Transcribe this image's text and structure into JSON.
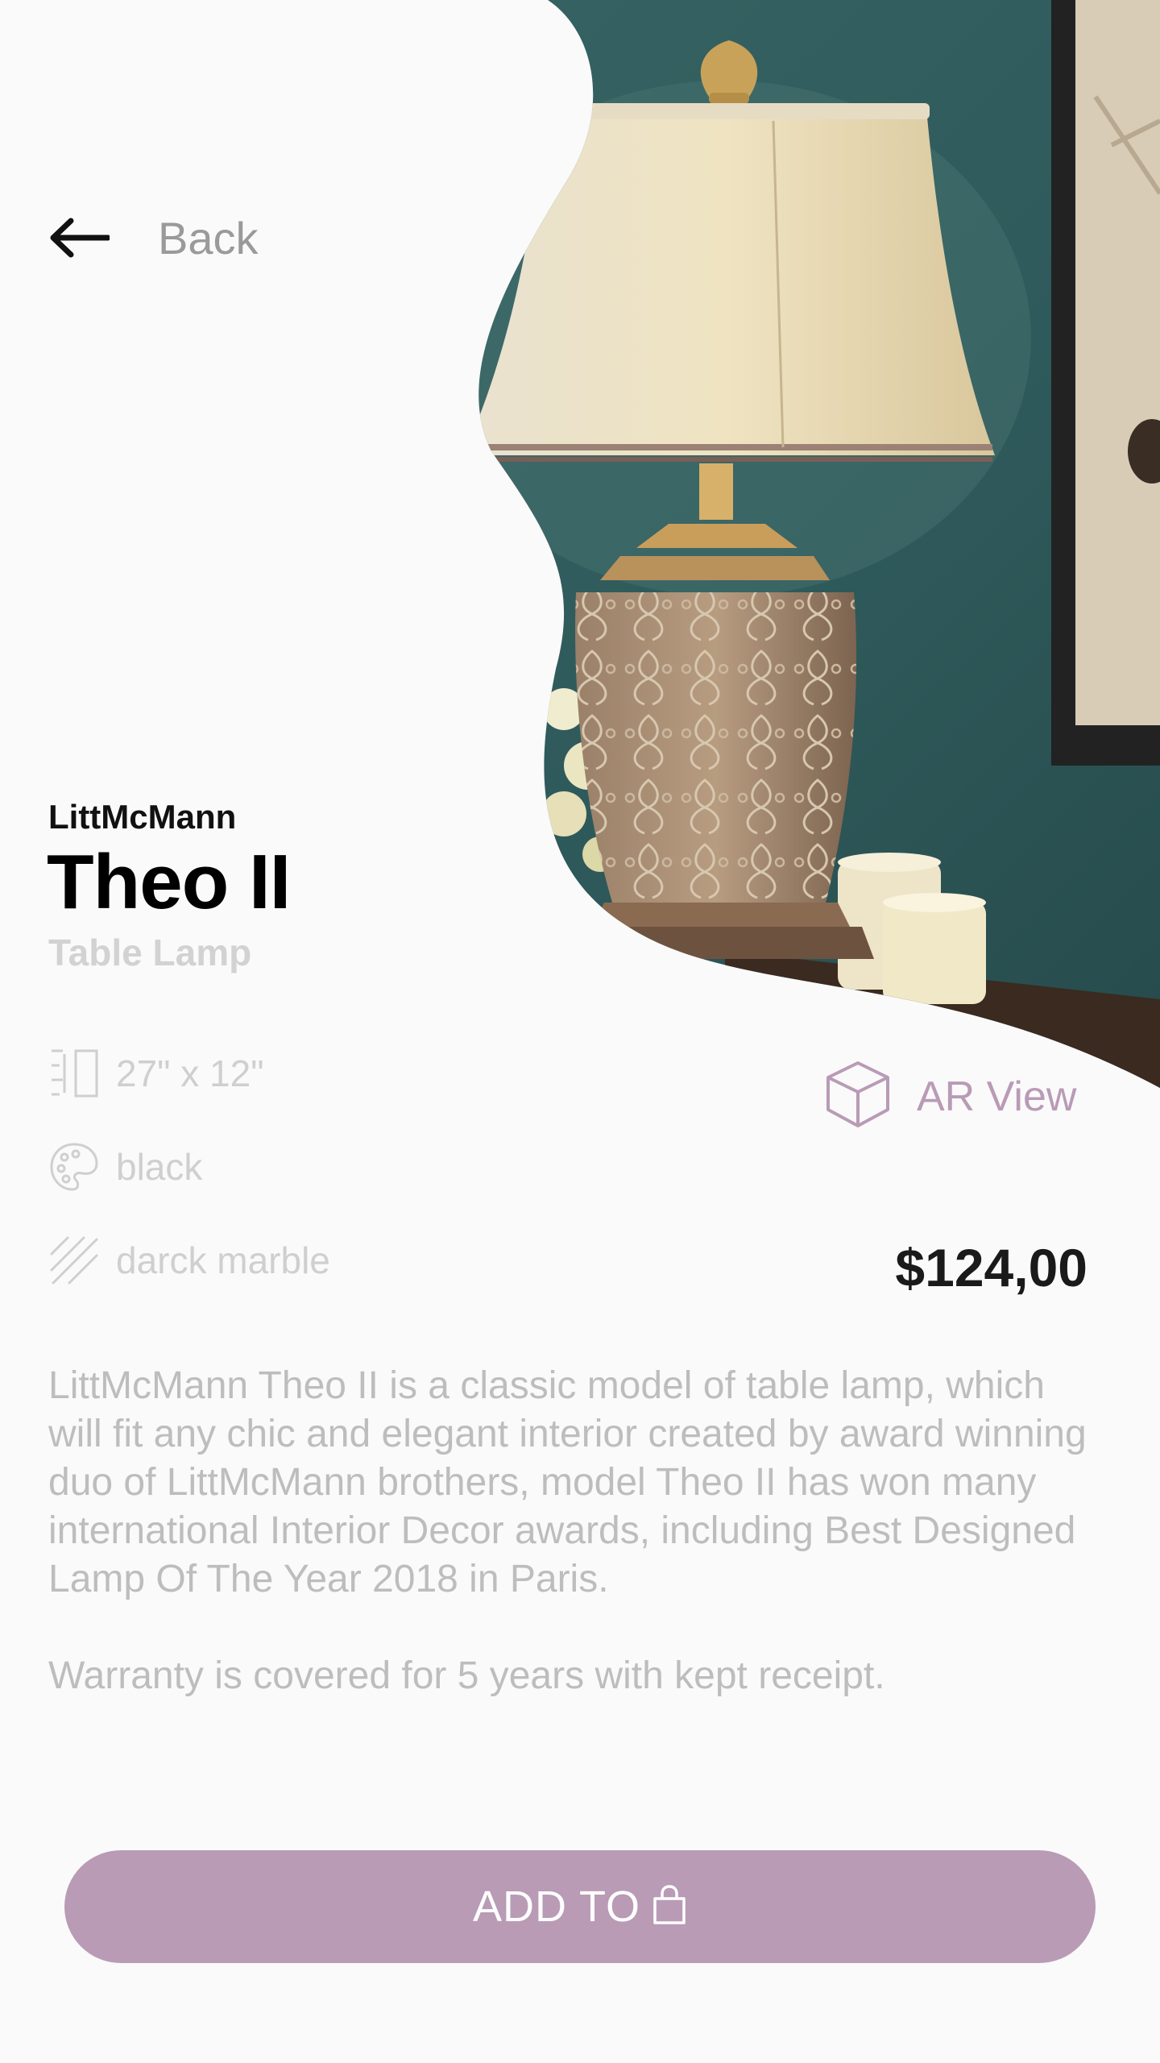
{
  "nav": {
    "back_label": "Back"
  },
  "product": {
    "brand": "LittMcMann",
    "name": "Theo II",
    "category": "Table Lamp",
    "price": "$124,00"
  },
  "specs": [
    {
      "icon": "dimensions-icon",
      "text": "27\" x 12\""
    },
    {
      "icon": "palette-icon",
      "text": "black"
    },
    {
      "icon": "material-icon",
      "text": "darck marble"
    }
  ],
  "ar": {
    "label": "AR View",
    "icon": "cube-icon"
  },
  "description": {
    "paragraph1": "LittMcMann Theo II is a classic model of table lamp, which will fit any chic and elegant interior created by award winning duo of LittMcMann brothers,  model Theo II has won many international Interior Decor awards, including Best Designed Lamp Of The Year 2018 in Paris.",
    "paragraph2": "Warranty is covered for 5 years with kept receipt."
  },
  "cta": {
    "label": "ADD TO",
    "icon": "shopping-bag-icon"
  },
  "colors": {
    "accent": "#b99bb6",
    "background": "#fafafa",
    "muted_text": "#bdbdbd",
    "wall": "#2f5a5b"
  }
}
